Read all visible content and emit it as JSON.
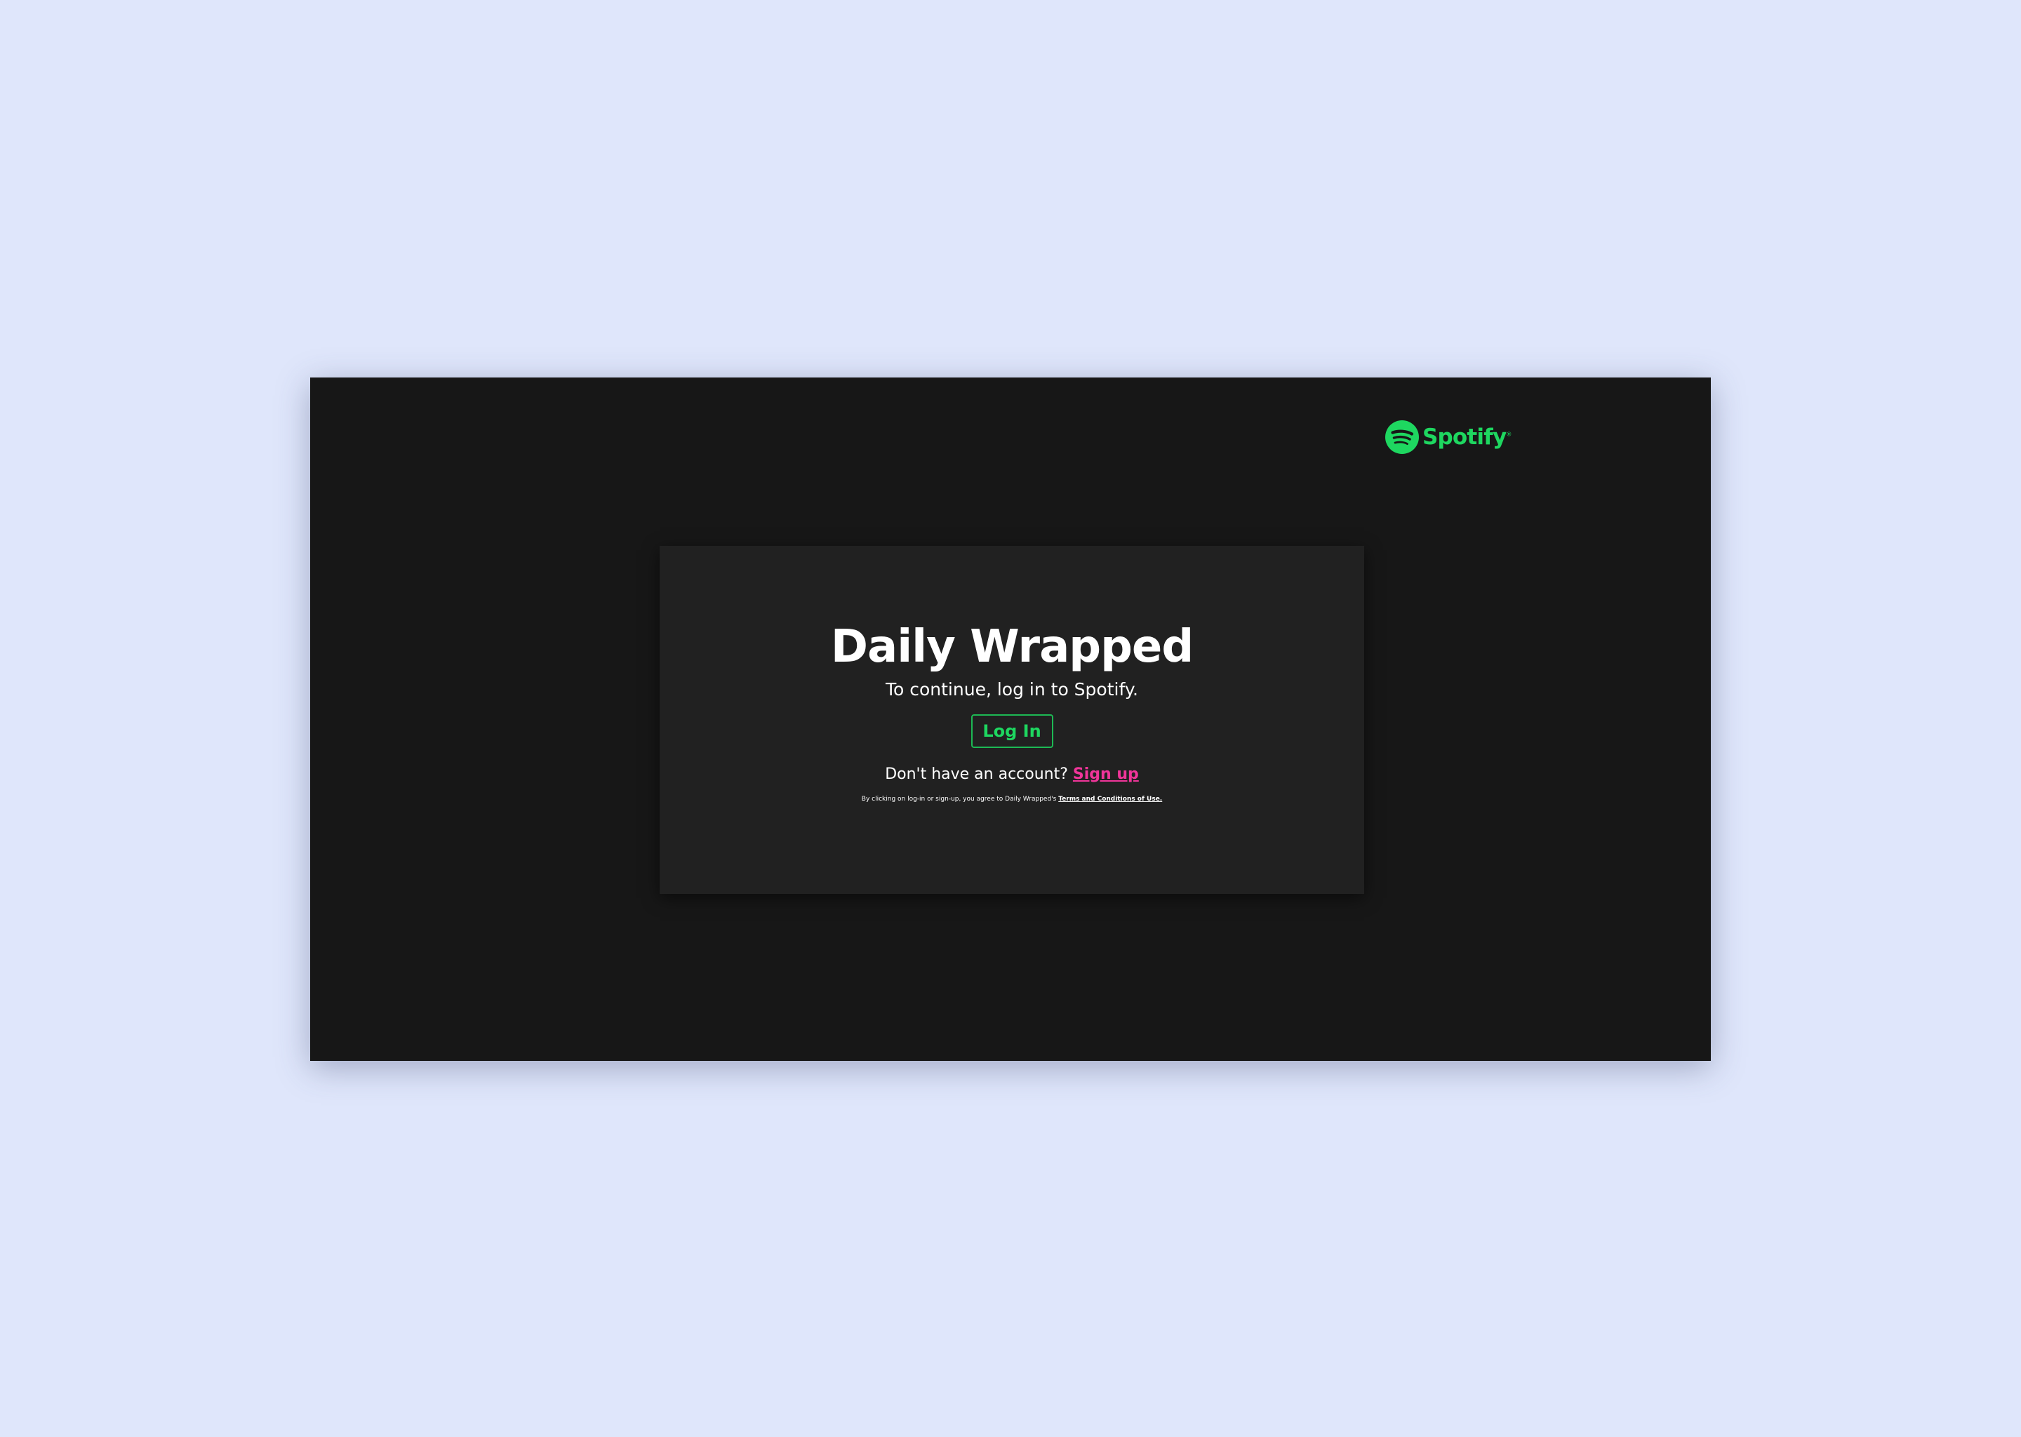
{
  "brand": {
    "name": "Spotify",
    "trademark": "®",
    "icon": "spotify-logo-icon",
    "color": "#1ed760"
  },
  "login": {
    "title": "Daily Wrapped",
    "subtitle": "To continue, log in to Spotify.",
    "login_button_label": "Log In",
    "signup_prompt": "Don't have an account?",
    "signup_link_label": "Sign up",
    "legal_text": "By clicking on log-in or sign-up, you agree to Daily Wrapped's",
    "terms_link_label": "Terms and Conditions of Use."
  },
  "colors": {
    "page_background": "#dfe6fb",
    "window_background": "#171717",
    "card_background": "#212121",
    "accent_green": "#1ed760",
    "accent_pink": "#f0359a"
  }
}
